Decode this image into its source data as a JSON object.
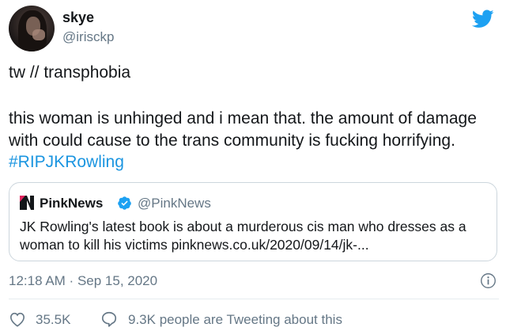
{
  "author": {
    "name": "skye",
    "handle": "@irisckp"
  },
  "tweet": {
    "content_warning": "tw // transphobia",
    "text": "this woman is unhinged and i mean that. the amount of damage with could cause to the trans community is fucking horrifying. ",
    "hashtag": "#RIPJKRowling"
  },
  "quoted_tweet": {
    "logo": "pinknews-logo",
    "name": "PinkNews",
    "verified": true,
    "handle": "@PinkNews",
    "text": "JK Rowling's latest book is about a murderous cis man who dresses as a woman to kill his victims pinknews.co.uk/2020/09/14/jk-..."
  },
  "meta": {
    "time": "12:18 AM",
    "separator": " · ",
    "date": "Sep 15, 2020"
  },
  "actions": {
    "likes": "35.5K",
    "talking": "9.3K people are Tweeting about this"
  },
  "colors": {
    "text": "#14171a",
    "secondary": "#657786",
    "accent": "#1b95e0",
    "twitter_blue": "#1da1f2",
    "border": "#ccd6dd"
  },
  "icons": [
    "twitter-bird-icon",
    "verified-badge-icon",
    "info-icon",
    "heart-icon",
    "speech-bubble-icon"
  ]
}
